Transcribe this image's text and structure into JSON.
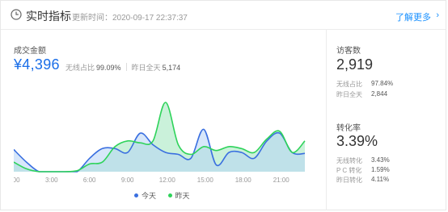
{
  "header": {
    "title": "实时指标",
    "update_label": "更新时间：",
    "update_time": "2020-09-17 22:37:37",
    "more_link": "了解更多",
    "more_chevron": "›"
  },
  "gmv": {
    "label": "成交金额",
    "value": "¥4,396",
    "wireless_label": "无线占比",
    "wireless_value": "99.09%",
    "yesterday_label": "昨日全天",
    "yesterday_value": "5,174"
  },
  "visitors": {
    "label": "访客数",
    "value": "2,919",
    "wireless_label": "无线占比",
    "wireless_value": "97.84%",
    "yesterday_label": "昨日全天",
    "yesterday_value": "2,844"
  },
  "conversion": {
    "label": "转化率",
    "value": "3.39%",
    "wireless_label": "无线转化",
    "wireless_value": "3.43%",
    "pc_label": "P C 转化",
    "pc_value": "1.59%",
    "yesterday_label": "昨日转化",
    "yesterday_value": "4.11%"
  },
  "legend": {
    "today": "今天",
    "yesterday": "昨天"
  },
  "colors": {
    "today": "#3a6fe0",
    "today_fill": "#b6d3f5",
    "yesterday": "#2ed35a",
    "yesterday_fill": "#a6e8c2",
    "link": "#1890ff"
  },
  "chart_data": {
    "type": "area",
    "x_labels": [
      "0:00",
      "3:00",
      "6:00",
      "9:00",
      "12:00",
      "15:00",
      "18:00",
      "21:00"
    ],
    "x": [
      0,
      1,
      2,
      3,
      4,
      5,
      6,
      7,
      8,
      9,
      10,
      11,
      12,
      13,
      14,
      15,
      16,
      17,
      18,
      19,
      20,
      21,
      22,
      23
    ],
    "series": [
      {
        "name": "今天",
        "values": [
          23,
          10,
          0,
          0,
          0,
          0,
          14,
          24,
          24,
          20,
          40,
          28,
          20,
          18,
          14,
          44,
          7,
          20,
          20,
          14,
          32,
          40,
          20,
          19
        ]
      },
      {
        "name": "昨天",
        "values": [
          10,
          3,
          0,
          0,
          0,
          1,
          8,
          10,
          26,
          32,
          30,
          32,
          72,
          28,
          18,
          26,
          22,
          26,
          24,
          20,
          34,
          42,
          20,
          32
        ]
      }
    ]
  }
}
